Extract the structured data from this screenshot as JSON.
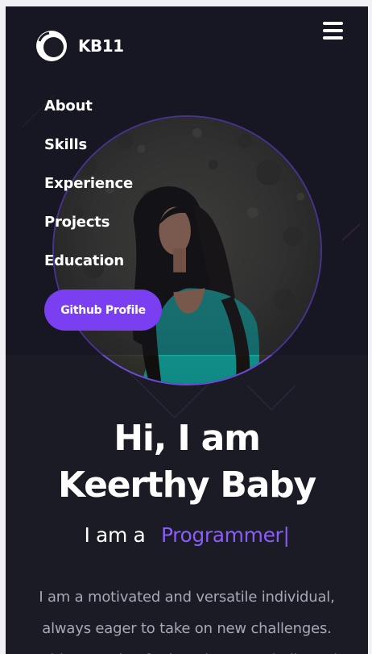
{
  "brand": {
    "name": "KB11",
    "logo_icon": "ring-logo-icon"
  },
  "header": {
    "menu_icon": "hamburger-menu-icon"
  },
  "nav": {
    "items": [
      {
        "label": "About"
      },
      {
        "label": "Skills"
      },
      {
        "label": "Experience"
      },
      {
        "label": "Projects"
      },
      {
        "label": "Education"
      }
    ],
    "github_button": "Github Profile"
  },
  "hero": {
    "greeting": "Hi, I am",
    "name": "Keerthy Baby",
    "role_prefix": "I am a",
    "role_word": "Programmer",
    "cursor": "|",
    "description_lines": [
      "I am a motivated and versatile individual,",
      "always eager to take on new challenges.",
      "With a passion for learning I am dedicated"
    ]
  },
  "colors": {
    "background": "#1b1b26",
    "accent": "#7a3ff0",
    "accent_text": "#8b5cf6",
    "muted_text": "#a7a8b3"
  }
}
